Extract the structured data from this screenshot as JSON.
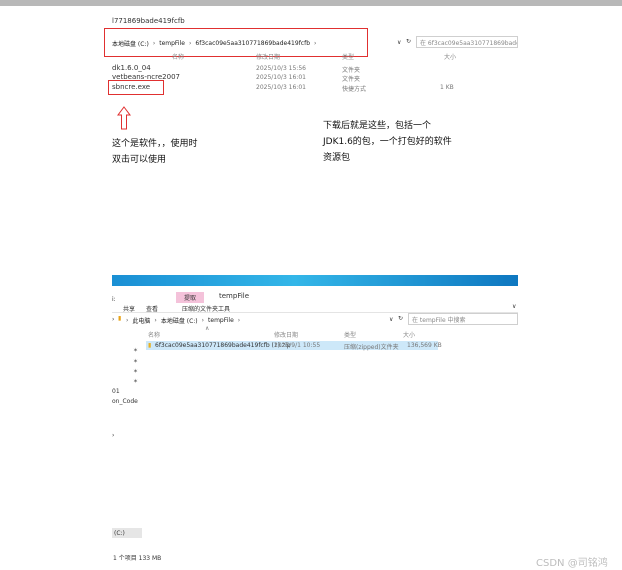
{
  "top_window": {
    "title": "l771869bade419fcfb",
    "breadcrumb": [
      "本地磁盘 (C:)",
      "tempFile",
      "6f3cac09e5aa310771869bade419fcfb"
    ],
    "search_placeholder": "在 6f3cac09e5aa310771869bade",
    "columns": [
      "名称",
      "修改日期",
      "类型",
      "大小"
    ],
    "files": [
      {
        "name": "dk1.6.0_04",
        "date": "2025/10/3 15:56",
        "type": "文件夹",
        "size": ""
      },
      {
        "name": "vetbeans-ncre2007",
        "date": "2025/10/3 16:01",
        "type": "文件夹",
        "size": ""
      },
      {
        "name": "sbncre.exe",
        "date": "2025/10/3 16:01",
        "type": "快捷方式",
        "size": "1 KB"
      }
    ]
  },
  "annotations": {
    "left_note": "这个是软件，，使用时双击可以使用",
    "right_note": "下载后就是这些，包括一个JDK1.6的包，一个打包好的软件资源包"
  },
  "bottom_window": {
    "ribbon_highlight": "提取",
    "title": "tempFile",
    "tabs": [
      "共享",
      "查看",
      "压缩的文件夹工具"
    ],
    "breadcrumb": [
      "此电脑",
      "本地磁盘 (C:)",
      "tempFile"
    ],
    "search_placeholder": "在 tempFile 中搜索",
    "columns": [
      "名称",
      "修改日期",
      "类型",
      "大小"
    ],
    "file": {
      "name": "6f3cac09e5aa310771869bade419fcfb (1).zip",
      "date": "2025/9/1 10:55",
      "type": "压缩(zipped)文件夹",
      "size": "136,569 KB"
    },
    "sidebar_fragments": [
      "01",
      "on_Code",
      "(C:)"
    ],
    "status": "1 个项目   133 MB"
  },
  "watermark": "CSDN @司铭鸿",
  "colors": {
    "annotation_red": "#e03030",
    "selection": "#cde8f9",
    "ribbon_pink": "#f4c2da",
    "banner_blue": "#1a8fd4"
  }
}
